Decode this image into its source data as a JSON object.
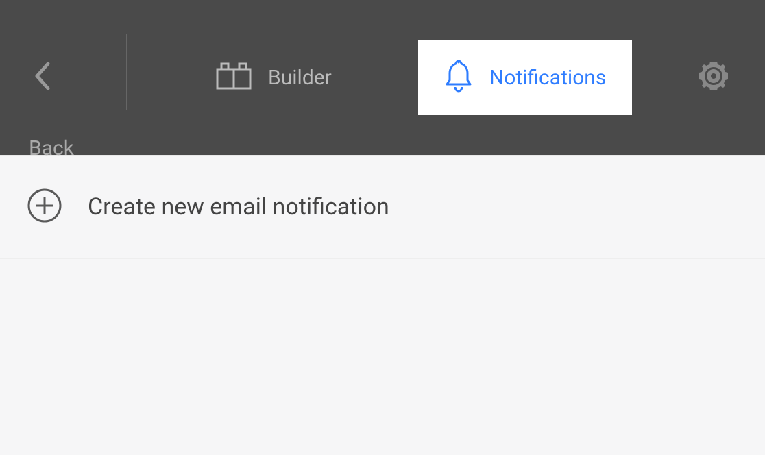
{
  "header": {
    "back_label": "Back",
    "tabs": {
      "builder": "Builder",
      "notifications": "Notifications"
    }
  },
  "content": {
    "create_label": "Create new email notification"
  }
}
